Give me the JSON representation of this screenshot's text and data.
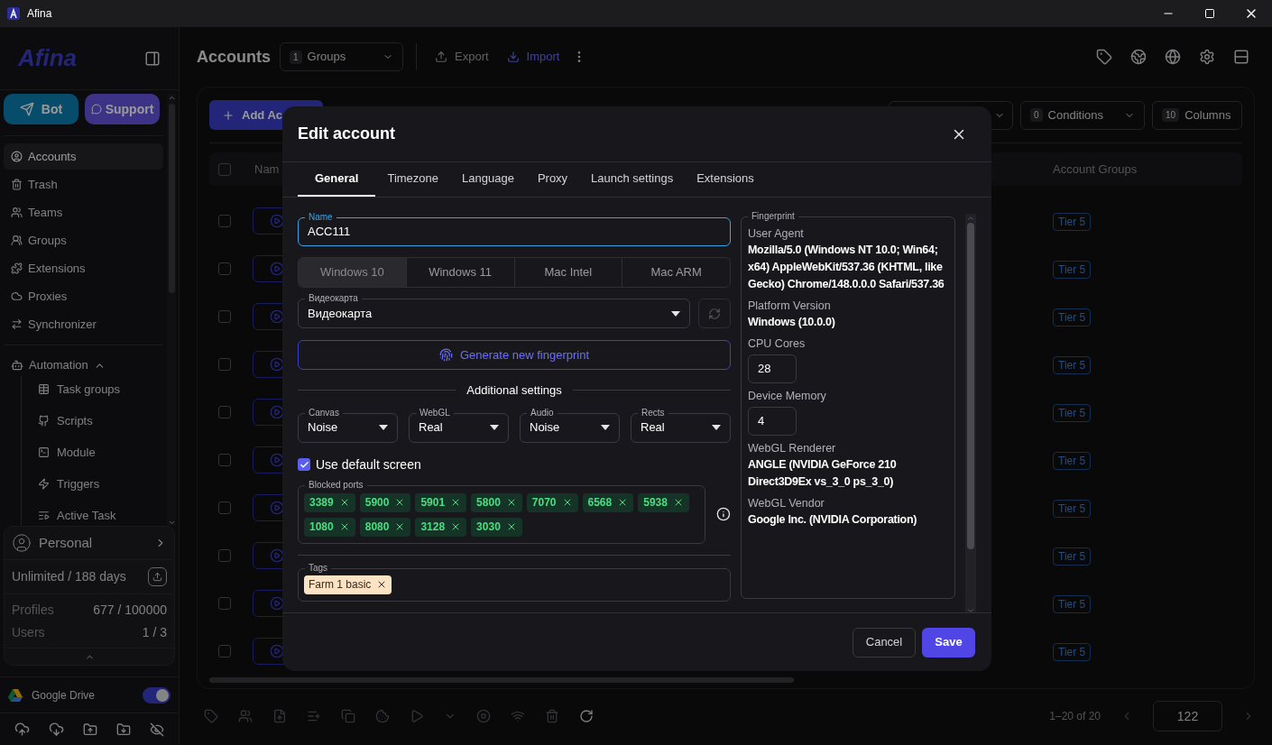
{
  "window": {
    "title": "Afina"
  },
  "sidebar": {
    "logo": "Afina",
    "bot_button": "Bot",
    "support_button": "Support",
    "nav": [
      {
        "label": "Accounts",
        "selected": true
      },
      {
        "label": "Trash",
        "selected": false
      },
      {
        "label": "Teams",
        "selected": false
      },
      {
        "label": "Groups",
        "selected": false
      },
      {
        "label": "Extensions",
        "selected": false
      },
      {
        "label": "Proxies",
        "selected": false
      },
      {
        "label": "Synchronizer",
        "selected": false
      }
    ],
    "automation": {
      "label": "Automation",
      "expanded": true,
      "children": [
        {
          "label": "Task groups"
        },
        {
          "label": "Scripts"
        },
        {
          "label": "Module"
        },
        {
          "label": "Triggers"
        },
        {
          "label": "Active Task"
        }
      ]
    },
    "plan": {
      "name": "Personal",
      "license": "Unlimited / 188 days",
      "stats": [
        {
          "label": "Profiles",
          "value": "677 / 100000"
        },
        {
          "label": "Users",
          "value": "1 / 3"
        }
      ]
    },
    "google_drive": {
      "label": "Google Drive",
      "on": true
    }
  },
  "header": {
    "title": "Accounts",
    "groups_count": "1",
    "groups_label": "Groups",
    "export": "Export",
    "import": "Import"
  },
  "toolbar": {
    "add_button": "Add Ac",
    "conditions_count": "0",
    "conditions": "Conditions",
    "columns_count": "10",
    "columns": "Columns"
  },
  "table": {
    "select_all": {
      "checked": false
    },
    "columns": [
      "Nam",
      "Account Groups"
    ],
    "rows": [
      {
        "checked": false,
        "group": "Tier 5"
      },
      {
        "checked": false,
        "group": "Tier 5"
      },
      {
        "checked": false,
        "group": "Tier 5"
      },
      {
        "checked": false,
        "group": "Tier 5"
      },
      {
        "checked": false,
        "group": "Tier 5"
      },
      {
        "checked": false,
        "group": "Tier 5"
      },
      {
        "checked": false,
        "group": "Tier 5"
      },
      {
        "checked": false,
        "group": "Tier 5"
      },
      {
        "checked": false,
        "group": "Tier 5"
      },
      {
        "checked": false,
        "group": "Tier 5"
      }
    ]
  },
  "footer": {
    "range": "1–20 of 20",
    "page": "122"
  },
  "dialog": {
    "title": "Edit account",
    "tabs": [
      {
        "label": "General",
        "selected": true
      },
      {
        "label": "Timezone",
        "selected": false
      },
      {
        "label": "Language",
        "selected": false
      },
      {
        "label": "Proxy",
        "selected": false
      },
      {
        "label": "Launch settings",
        "selected": false
      },
      {
        "label": "Extensions",
        "selected": false
      }
    ],
    "name_field": {
      "label": "Name",
      "value": "ACC111"
    },
    "os_options": [
      {
        "label": "Windows 10",
        "selected": true
      },
      {
        "label": "Windows 11",
        "selected": false
      },
      {
        "label": "Mac Intel",
        "selected": false
      },
      {
        "label": "Mac ARM",
        "selected": false
      }
    ],
    "gpu": {
      "label": "Видеокарта",
      "value": "Видеокарта"
    },
    "generate_button": "Generate new fingerprint",
    "additional_heading": "Additional settings",
    "noise_settings": [
      {
        "label": "Canvas",
        "value": "Noise"
      },
      {
        "label": "WebGL",
        "value": "Real"
      },
      {
        "label": "Audio",
        "value": "Noise"
      },
      {
        "label": "Rects",
        "value": "Real"
      }
    ],
    "default_screen": {
      "label": "Use default screen",
      "checked": true
    },
    "blocked_ports": {
      "label": "Blocked ports",
      "ports": [
        "3389",
        "5900",
        "5901",
        "5800",
        "7070",
        "6568",
        "5938",
        "1080",
        "8080",
        "3128",
        "3030"
      ]
    },
    "tags": {
      "label": "Tags",
      "items": [
        "Farm 1 basic"
      ]
    },
    "fingerprint": {
      "label": "Fingerprint",
      "fields": [
        {
          "label": "User Agent",
          "value": "Mozilla/5.0 (Windows NT 10.0; Win64; x64) AppleWebKit/537.36 (KHTML, like Gecko) Chrome/148.0.0.0 Safari/537.36",
          "kind": "text"
        },
        {
          "label": "Platform Version",
          "value": "Windows (10.0.0)",
          "kind": "text"
        },
        {
          "label": "CPU Cores",
          "value": "28",
          "kind": "input"
        },
        {
          "label": "Device Memory",
          "value": "4",
          "kind": "input"
        },
        {
          "label": "WebGL Renderer",
          "value": "ANGLE (NVIDIA GeForce 210 Direct3D9Ex vs_3_0 ps_3_0)",
          "kind": "text"
        },
        {
          "label": "WebGL Vendor",
          "value": "Google Inc. (NVIDIA Corporation)",
          "kind": "text"
        }
      ]
    },
    "cancel_button": "Cancel",
    "save_button": "Save"
  }
}
